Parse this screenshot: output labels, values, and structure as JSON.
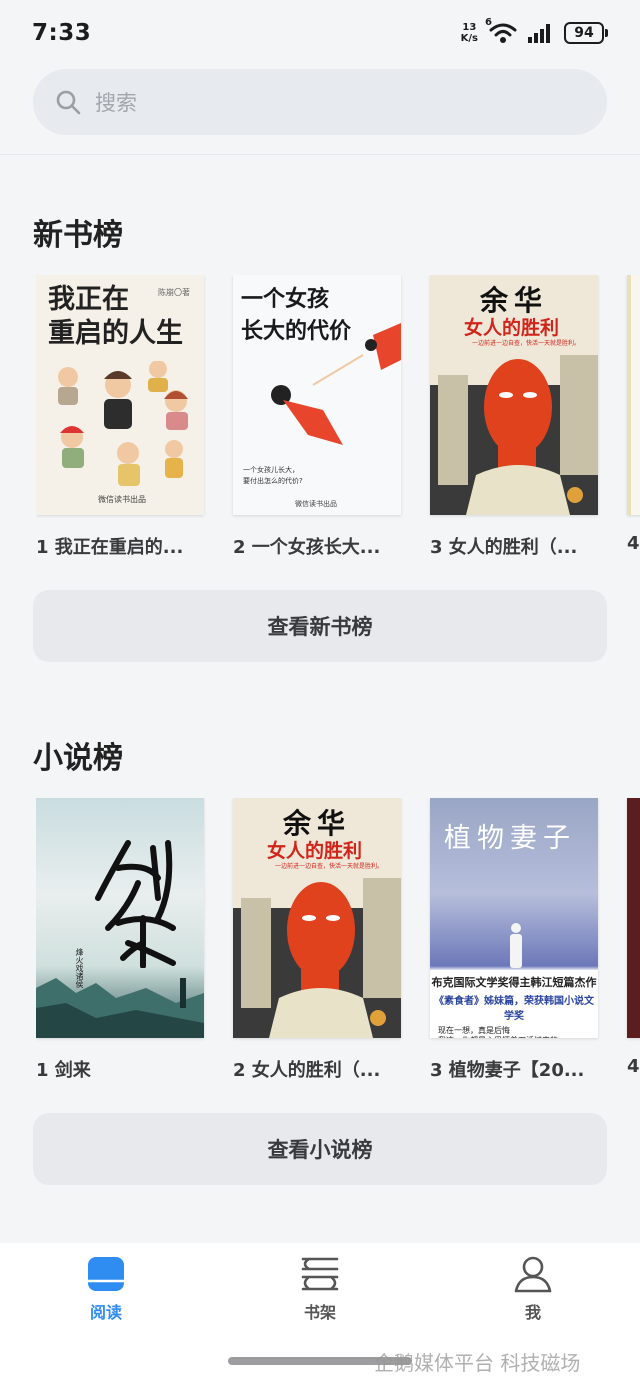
{
  "status_bar": {
    "time": "7:33",
    "net_speed_value": "13",
    "net_speed_unit": "K/s",
    "wifi_badge": "6",
    "battery": "94"
  },
  "search": {
    "placeholder": "搜索"
  },
  "sections": [
    {
      "title": "新书榜",
      "books": [
        {
          "caption": "1 我正在重启的...",
          "cover_title": "我正在\n重启的人生",
          "cover_author": "陈崩〇著",
          "cover_publisher": "微信读书出品"
        },
        {
          "caption": "2 一个女孩长大...",
          "cover_title": "一个女孩\n长大的代价",
          "cover_subtitle": "一个女孩儿长大，\n要付出怎么的代价?",
          "cover_publisher": "微信读书出品"
        },
        {
          "caption": "3 女人的胜利（...",
          "cover_author": "余华",
          "cover_title": "女人的胜利",
          "cover_slogan": "一边前进一边自查，快活一天就是胜利。"
        },
        {
          "caption": "4"
        }
      ],
      "button": "查看新书榜"
    },
    {
      "title": "小说榜",
      "books": [
        {
          "caption": "1 剑来",
          "cover_title": "剑来",
          "cover_author": "烽火戏诸侯"
        },
        {
          "caption": "2 女人的胜利（...",
          "cover_author": "余华",
          "cover_title": "女人的胜利",
          "cover_slogan": "一边前进一边自查，快活一天就是胜利。"
        },
        {
          "caption": "3 植物妻子【20...",
          "cover_title": "植物妻子",
          "cover_line1": "布克国际文学奖得主韩江短篇杰作",
          "cover_line2": "《素食者》姊妹篇，荣获韩国小说文学奖",
          "cover_line3": "现在一想，真是后悔\n我这一生都是心里怀着刀活过来的"
        },
        {
          "caption": "4"
        }
      ],
      "button": "查看小说榜"
    }
  ],
  "tabs": [
    {
      "label": "阅读",
      "icon": "book-icon",
      "active": true
    },
    {
      "label": "书架",
      "icon": "bookshelf-icon",
      "active": false
    },
    {
      "label": "我",
      "icon": "person-icon",
      "active": false
    }
  ],
  "watermark": "企鹅媒体平台 科技磁场",
  "colors": {
    "accent": "#2f8cf0",
    "background": "#f3f5f7",
    "cover_red": "#d1241b"
  }
}
